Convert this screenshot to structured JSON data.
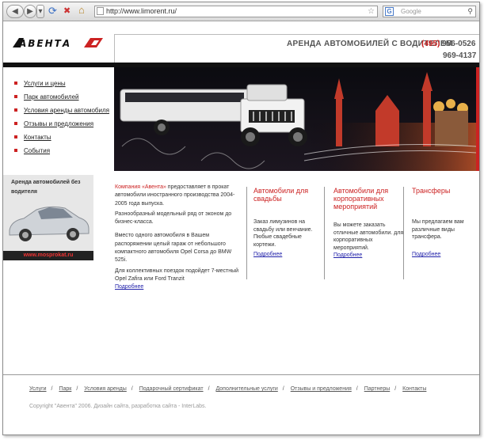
{
  "browser": {
    "back_icon": "back-arrow-icon",
    "forward_icon": "forward-arrow-icon",
    "url": "http://www.limorent.ru/",
    "search_placeholder": "Google"
  },
  "header": {
    "logo_text": "АВЕНТА",
    "slogan": "АРЕНДА АВТОМОБИЛЕЙ С ВОДИТЕЛЕМ",
    "phone_code": "(495)",
    "phone1": "956-0526",
    "phone2": "969-4137"
  },
  "nav": {
    "items": [
      {
        "label": "Услуги и цены"
      },
      {
        "label": "Парк автомобилей"
      },
      {
        "label": "Условия аренды автомобиля"
      },
      {
        "label": "Отзывы и предложения"
      },
      {
        "label": "Контакты"
      },
      {
        "label": "События"
      }
    ]
  },
  "promo": {
    "title": "Аренда автомобилей без водителя",
    "url": "www.mosprokat.ru"
  },
  "intro": {
    "company": "Компания «Авента»",
    "p1_rest": " предоставляет в прокат автомобили иностранного производства 2004-2005 года выпуска.",
    "p2": "Разнообразный модельный ряд от эконом до бизнес-класса.",
    "p3": "Вместо одного автомобиля в Вашем распоряжении целый гараж от небольшого компактного автомобиля Opel Corsa до BMW 525i.",
    "p4": "Для коллективных  поездок подойдет 7-местный Opel Zafira или Ford Tranzit",
    "more": "Подробнее"
  },
  "columns": [
    {
      "title": "Автомобили для свадьбы",
      "text": "Заказ лимузинов на свадьбу или венчание. Пюбые свадебные кортежи.",
      "more": "Подробнее"
    },
    {
      "title": "Автомобили для корпоративных мероприятий",
      "text": "Вы можете заказать отличные автомобили. для корпоративных мероприятий.",
      "more": "Подробнее"
    },
    {
      "title": "Трансферы",
      "text": "Мы предлагаем вам различные виды трансфера.",
      "more": "Подробнее"
    }
  ],
  "footer": {
    "links": [
      "Услуги",
      "Парк",
      "Условия аренды",
      "Подарочный сертификат",
      "Дополнительные услуги",
      "Отзывы и предложения",
      "Партнеры",
      "Контакты"
    ],
    "separator": "/",
    "copyright": "Copyright \"Авента\" 2006.   Дизайн сайта, разработка сайта - InterLabs."
  },
  "colors": {
    "accent": "#cc2222",
    "link": "#2222aa",
    "bar": "#111111"
  }
}
